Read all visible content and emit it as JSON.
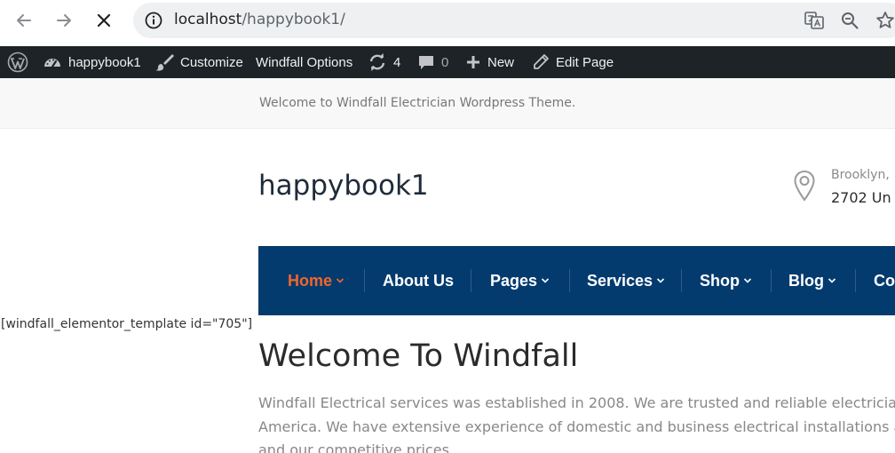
{
  "browser": {
    "url_host": "localhost",
    "url_path": "/happybook1/",
    "icons": [
      "back-arrow-icon",
      "forward-arrow-icon",
      "stop-loading-icon",
      "site-info-icon",
      "translate-icon",
      "zoom-icon",
      "bookmark-star-icon"
    ]
  },
  "admin_bar": {
    "site_name": "happybook1",
    "customize": "Customize",
    "theme_options": "Windfall Options",
    "updates_count": "4",
    "comments_count": "0",
    "new_label": "New",
    "edit_page": "Edit Page"
  },
  "header": {
    "welcome": "Welcome to Windfall Electrician Wordpress Theme.",
    "site_title": "happybook1",
    "address_line1": "Brooklyn,",
    "address_line2": "2702 Un"
  },
  "nav": {
    "items": [
      {
        "label": "Home",
        "has_dropdown": true,
        "active": true
      },
      {
        "label": "About Us",
        "has_dropdown": false,
        "active": false
      },
      {
        "label": "Pages",
        "has_dropdown": true,
        "active": false
      },
      {
        "label": "Services",
        "has_dropdown": true,
        "active": false
      },
      {
        "label": "Shop",
        "has_dropdown": true,
        "active": false
      },
      {
        "label": "Blog",
        "has_dropdown": true,
        "active": false
      },
      {
        "label": "Co",
        "has_dropdown": false,
        "active": false
      }
    ]
  },
  "content": {
    "shortcode": "[windfall_elementor_template id=\"705\"]",
    "heading": "Welcome To Windfall",
    "paragraph_lines": [
      "Windfall Electrical services was established in 2008. We are trusted and reliable electricians",
      "America. We have extensive experience of domestic and business electrical installations an",
      "and our competitive prices"
    ]
  },
  "colors": {
    "admin_bar_bg": "#1d2327",
    "nav_bg": "#043b6f",
    "nav_active": "#f0662a"
  }
}
